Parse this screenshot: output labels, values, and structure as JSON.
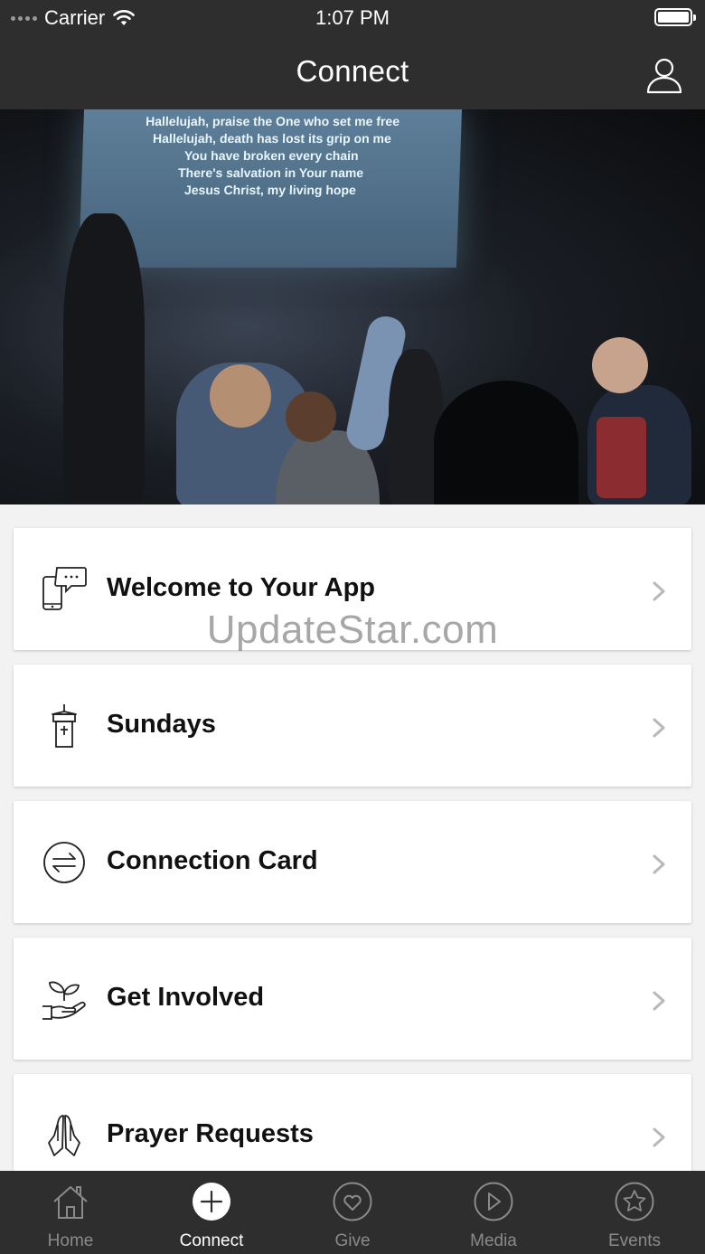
{
  "status_bar": {
    "carrier": "Carrier",
    "time": "1:07 PM"
  },
  "header": {
    "title": "Connect",
    "profile_icon": "person-icon"
  },
  "hero": {
    "lyrics": [
      "Hallelujah, praise the One who set me free",
      "Hallelujah, death has lost its grip on me",
      "You have broken every chain",
      "There's salvation in Your name",
      "Jesus Christ, my living hope"
    ]
  },
  "watermark": "UpdateStar.com",
  "cards": [
    {
      "label": "Welcome to Your App",
      "icon": "phone-chat-icon"
    },
    {
      "label": "Sundays",
      "icon": "church-tower-icon"
    },
    {
      "label": "Connection Card",
      "icon": "exchange-arrows-icon"
    },
    {
      "label": "Get Involved",
      "icon": "hand-plant-icon"
    },
    {
      "label": "Prayer Requests",
      "icon": "praying-hands-icon"
    }
  ],
  "tabs": [
    {
      "label": "Home",
      "icon": "home-icon",
      "active": false
    },
    {
      "label": "Connect",
      "icon": "plus-circle-icon",
      "active": true
    },
    {
      "label": "Give",
      "icon": "heart-circle-icon",
      "active": false
    },
    {
      "label": "Media",
      "icon": "play-circle-icon",
      "active": false
    },
    {
      "label": "Events",
      "icon": "star-circle-icon",
      "active": false
    }
  ],
  "colors": {
    "bar_background": "#2e2e2e",
    "page_background": "#f2f2f2",
    "active_tab": "#ffffff",
    "inactive_tab": "#8a8a8a"
  }
}
